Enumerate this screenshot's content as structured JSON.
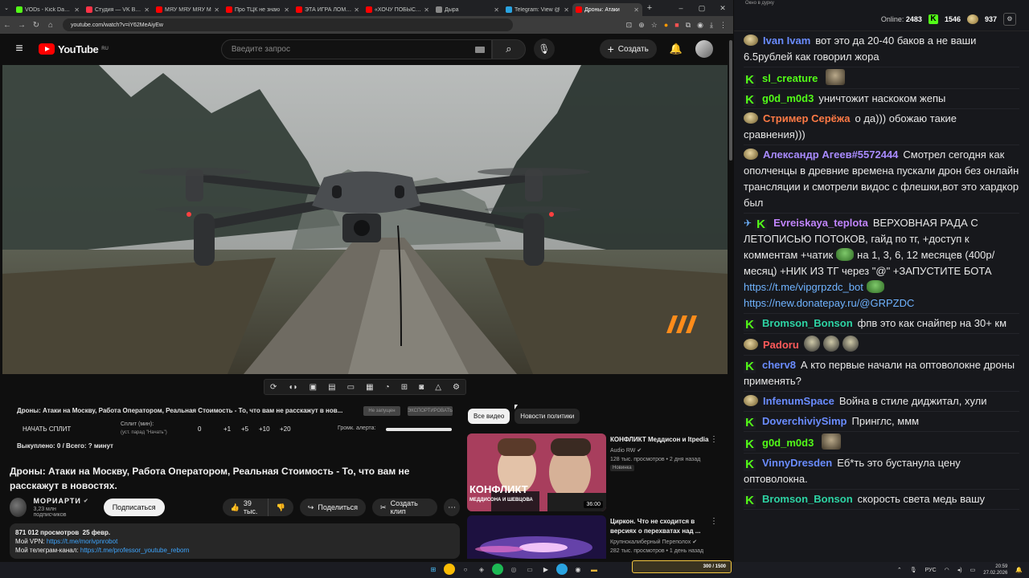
{
  "browser": {
    "tabs": [
      {
        "label": "VODs - Kick Dashb",
        "color": "#53fc18",
        "active": false
      },
      {
        "label": "Студия — VK Видео",
        "color": "#ff3347",
        "active": false
      },
      {
        "label": "МЯУ МЯУ МЯУ М",
        "color": "#ff0000",
        "active": false
      },
      {
        "label": "Про ТЦК не знаю",
        "color": "#ff0000",
        "active": false
      },
      {
        "label": "ЭТА ИГРА ЛОМАЕ",
        "color": "#ff0000",
        "active": false
      },
      {
        "label": "«ХОЧУ ПОБЫСТРЕ",
        "color": "#ff0000",
        "active": false
      },
      {
        "label": "Дыра",
        "color": "#888888",
        "active": false
      },
      {
        "label": "Telegram: View @",
        "color": "#2aa3e0",
        "active": false
      },
      {
        "label": "Дроны: Атаки",
        "color": "#ff0000",
        "active": true
      }
    ],
    "url": "youtube.com/watch?v=iY62MeAiyEw"
  },
  "youtube": {
    "logo_text": "YouTube",
    "region": "RU",
    "search_placeholder": "Введите запрос",
    "create_label": "Создать"
  },
  "ext": {
    "title": "Дроны: Атаки на Москву, Работа Оператором, Реальная Стоимость - То, что вам не расскажут в нов...",
    "pill1": "Не запущен",
    "pill2": "ЭКСПОРТИРОВАТЬ",
    "start_split": "НАЧАТЬ СПЛИТ",
    "split_label": "Сплит (мин):",
    "split_sub": "(уст. парад \"Начать\")",
    "values": [
      "0",
      "+1",
      "+5",
      "+10",
      "+20"
    ],
    "alert_label": "Громк. алерта:",
    "bought": "Выкуплено: 0 / Всего: ? минут"
  },
  "video": {
    "title": "Дроны: Атаки на Москву, Работа Оператором, Реальная Стоимость - То, что вам не расскажут в новостях.",
    "channel": "МОРИАРТИ",
    "subs": "3,23 млн подписчиков",
    "subscribe": "Подписаться",
    "likes": "39 тыс.",
    "share": "Поделиться",
    "clip": "Создать клип",
    "views": "871 012 просмотров",
    "date": "25 февр.",
    "vpn_label": "Мой VPN:",
    "vpn_link": "https://t.me/morivpnrobot",
    "tg_label": "Мой телеграм-канал:",
    "tg_link": "https://t.me/professor_youtube_reborn"
  },
  "chips": [
    "Все видео",
    "Новости политики"
  ],
  "recs": [
    {
      "title": "КОНФЛИКТ Меддисон и Itpedia",
      "channel": "Audio RW",
      "meta": "128 тыс. просмотров • 2 дня назад",
      "badge": "Новинка",
      "duration": "36:00",
      "thumb_text": "КОНФЛИКТ",
      "thumb_sub": "МЕДДИСОНА И ШЕВЦОВА"
    },
    {
      "title": "Циркон. Что не сходится в версиях о перехватах над ...",
      "channel": "Крупнокалиберный Переполох",
      "meta": "282 тыс. просмотров • 1 день назад",
      "badge": "",
      "duration": "",
      "thumb_text": "",
      "thumb_sub": ""
    }
  ],
  "chat": {
    "window_title": "Окно в дурку",
    "online_label": "Online:",
    "online": "2483",
    "stat1": "1546",
    "stat2": "937",
    "messages": [
      {
        "user": "Ivan Ivam",
        "color": "#6a8cff",
        "badge": "emote",
        "text": "вот это да 20-40 баков  а не ваши 6.5рублей как говорил жора"
      },
      {
        "user": "sl_creature",
        "color": "#53fc18",
        "badge": "kick",
        "text": "",
        "emote": true
      },
      {
        "user": "g0d_m0d3",
        "color": "#53fc18",
        "badge": "kick",
        "text": "уничтожит наскоком жепы"
      },
      {
        "user": "Стример Серёжа",
        "color": "#ff7a45",
        "badge": "emote",
        "text": "о да))) обожаю такие сравнения)))"
      },
      {
        "user": "Александр Агеев#5572444",
        "color": "#a98bff",
        "badge": "emote",
        "text": "Смотрел сегодня как ополченцы в древние времена пускали дрон без онлайн трансляции и смотрели видос с флешки,вот это хардкор был"
      },
      {
        "user": "Evreiskaya_teplota",
        "color": "#c084fc",
        "badge": "kick-pin",
        "text": "ВЕРХОВНАЯ РАДА С ЛЕТОПИСЬЮ ПОТОКОВ, гайд по тг, +доступ к комментам +чатик",
        "text2": "на 1, 3, 6, 12 месяцев (400р/месяц) +НИК ИЗ ТГ через \"@\" +ЗАПУСТИТЕ БОТА",
        "link1": "https://t.me/vipgrpzdc_bot",
        "link2": "https://new.donatepay.ru/@GRPZDC"
      },
      {
        "user": "Bromson_Bonson",
        "color": "#2dd4a4",
        "badge": "kick",
        "text": "фпв это как снайпер на 30+ км"
      },
      {
        "user": "Padoru",
        "color": "#ff5a5a",
        "badge": "emote",
        "text": "",
        "helmets": 3
      },
      {
        "user": "cherv8",
        "color": "#6a8cff",
        "badge": "kick",
        "text": "А кто первые начали на оптоволокне дроны применять?"
      },
      {
        "user": "InfenumSpace",
        "color": "#6a8cff",
        "badge": "emote",
        "text": "Война в стиле диджитал, хули"
      },
      {
        "user": "DoverchiviySimp",
        "color": "#6a8cff",
        "badge": "kick",
        "text": "Принглс, ммм"
      },
      {
        "user": "g0d_m0d3",
        "color": "#53fc18",
        "badge": "kick",
        "text": "",
        "emote": true
      },
      {
        "user": "VinnyDresden",
        "color": "#6a8cff",
        "badge": "kick",
        "text": "Еб*ть это бустанула цену оптоволокна."
      },
      {
        "user": "Bromson_Bonson",
        "color": "#2dd4a4",
        "badge": "kick",
        "text": "скорость света медь вашу"
      }
    ]
  },
  "taskbar": {
    "widget_text": "300 / 1500",
    "lang": "РУС",
    "time": "20:59",
    "date": "27.02.2026"
  }
}
